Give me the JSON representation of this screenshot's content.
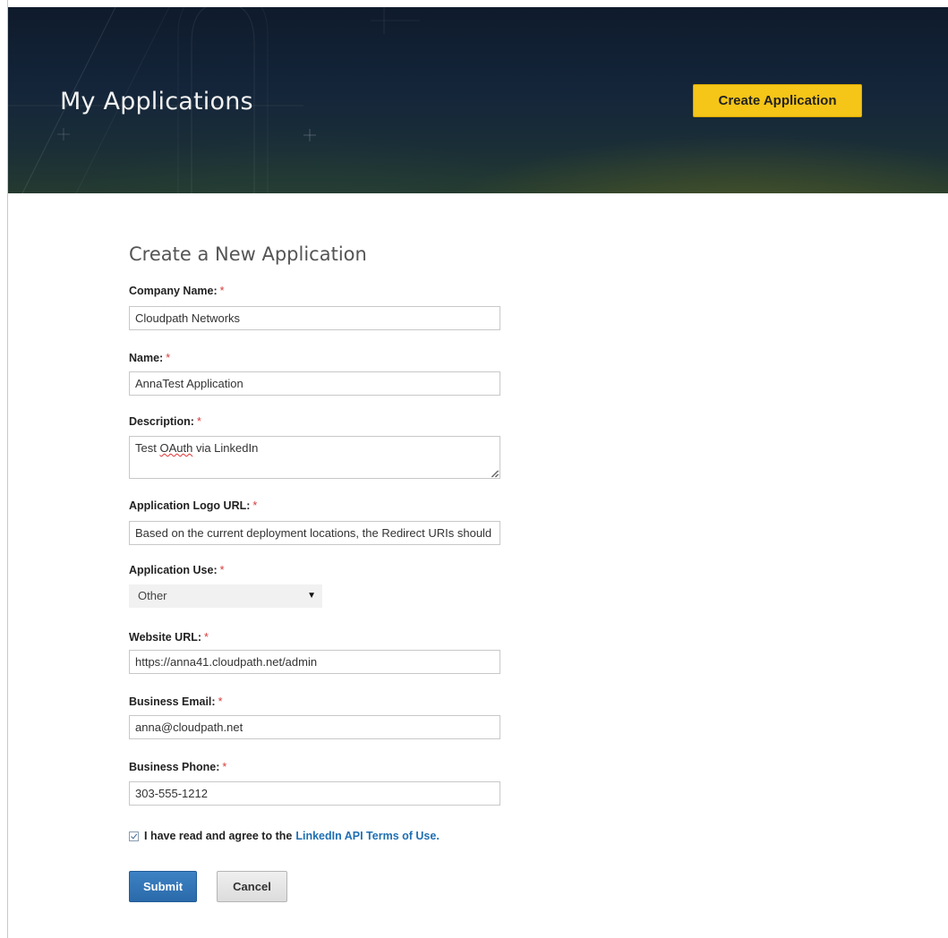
{
  "header": {
    "title": "My Applications",
    "create_button_label": "Create Application"
  },
  "form": {
    "title": "Create a New Application",
    "required_marker": "*",
    "company_name": {
      "label": "Company Name:",
      "value": "Cloudpath Networks"
    },
    "name": {
      "label": "Name:",
      "value": "AnnaTest Application"
    },
    "description": {
      "label": "Description:",
      "value_prefix": "Test ",
      "value_misspelled": "OAuth",
      "value_suffix": " via LinkedIn"
    },
    "logo_url": {
      "label": "Application Logo URL:",
      "value": "Based on the current deployment locations, the Redirect URIs should be:"
    },
    "application_use": {
      "label": "Application Use:",
      "selected": "Other",
      "arrow_icon": "triangle-down"
    },
    "website_url": {
      "label": "Website URL:",
      "value": "https://anna41.cloudpath.net/admin"
    },
    "business_email": {
      "label": "Business Email:",
      "value": "anna@cloudpath.net"
    },
    "business_phone": {
      "label": "Business Phone:",
      "value": "303-555-1212"
    },
    "agree": {
      "checked": true,
      "text": "I have read and agree to the",
      "link_text": "LinkedIn API Terms of Use."
    },
    "submit_label": "Submit",
    "cancel_label": "Cancel"
  },
  "colors": {
    "accent_yellow": "#f5c518",
    "submit_blue": "#2f74b5",
    "link_blue": "#1f6fb2",
    "required_red": "#d63b3b"
  }
}
